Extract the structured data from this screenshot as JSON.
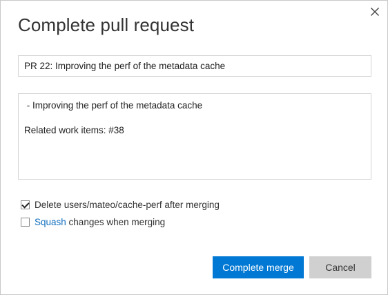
{
  "dialog": {
    "title": "Complete pull request",
    "close_icon": "close-icon"
  },
  "form": {
    "title_value": "PR 22: Improving the perf of the metadata cache",
    "description_value": " - Improving the perf of the metadata cache\n\nRelated work items: #38",
    "delete_branch": {
      "checked": true,
      "label": "Delete users/mateo/cache-perf after merging"
    },
    "squash": {
      "checked": false,
      "link_text": "Squash",
      "label_rest": " changes when merging"
    }
  },
  "buttons": {
    "complete_label": "Complete merge",
    "cancel_label": "Cancel"
  },
  "colors": {
    "primary": "#0078d4",
    "link": "#106ebe",
    "secondary_button": "#d0d0d0"
  }
}
